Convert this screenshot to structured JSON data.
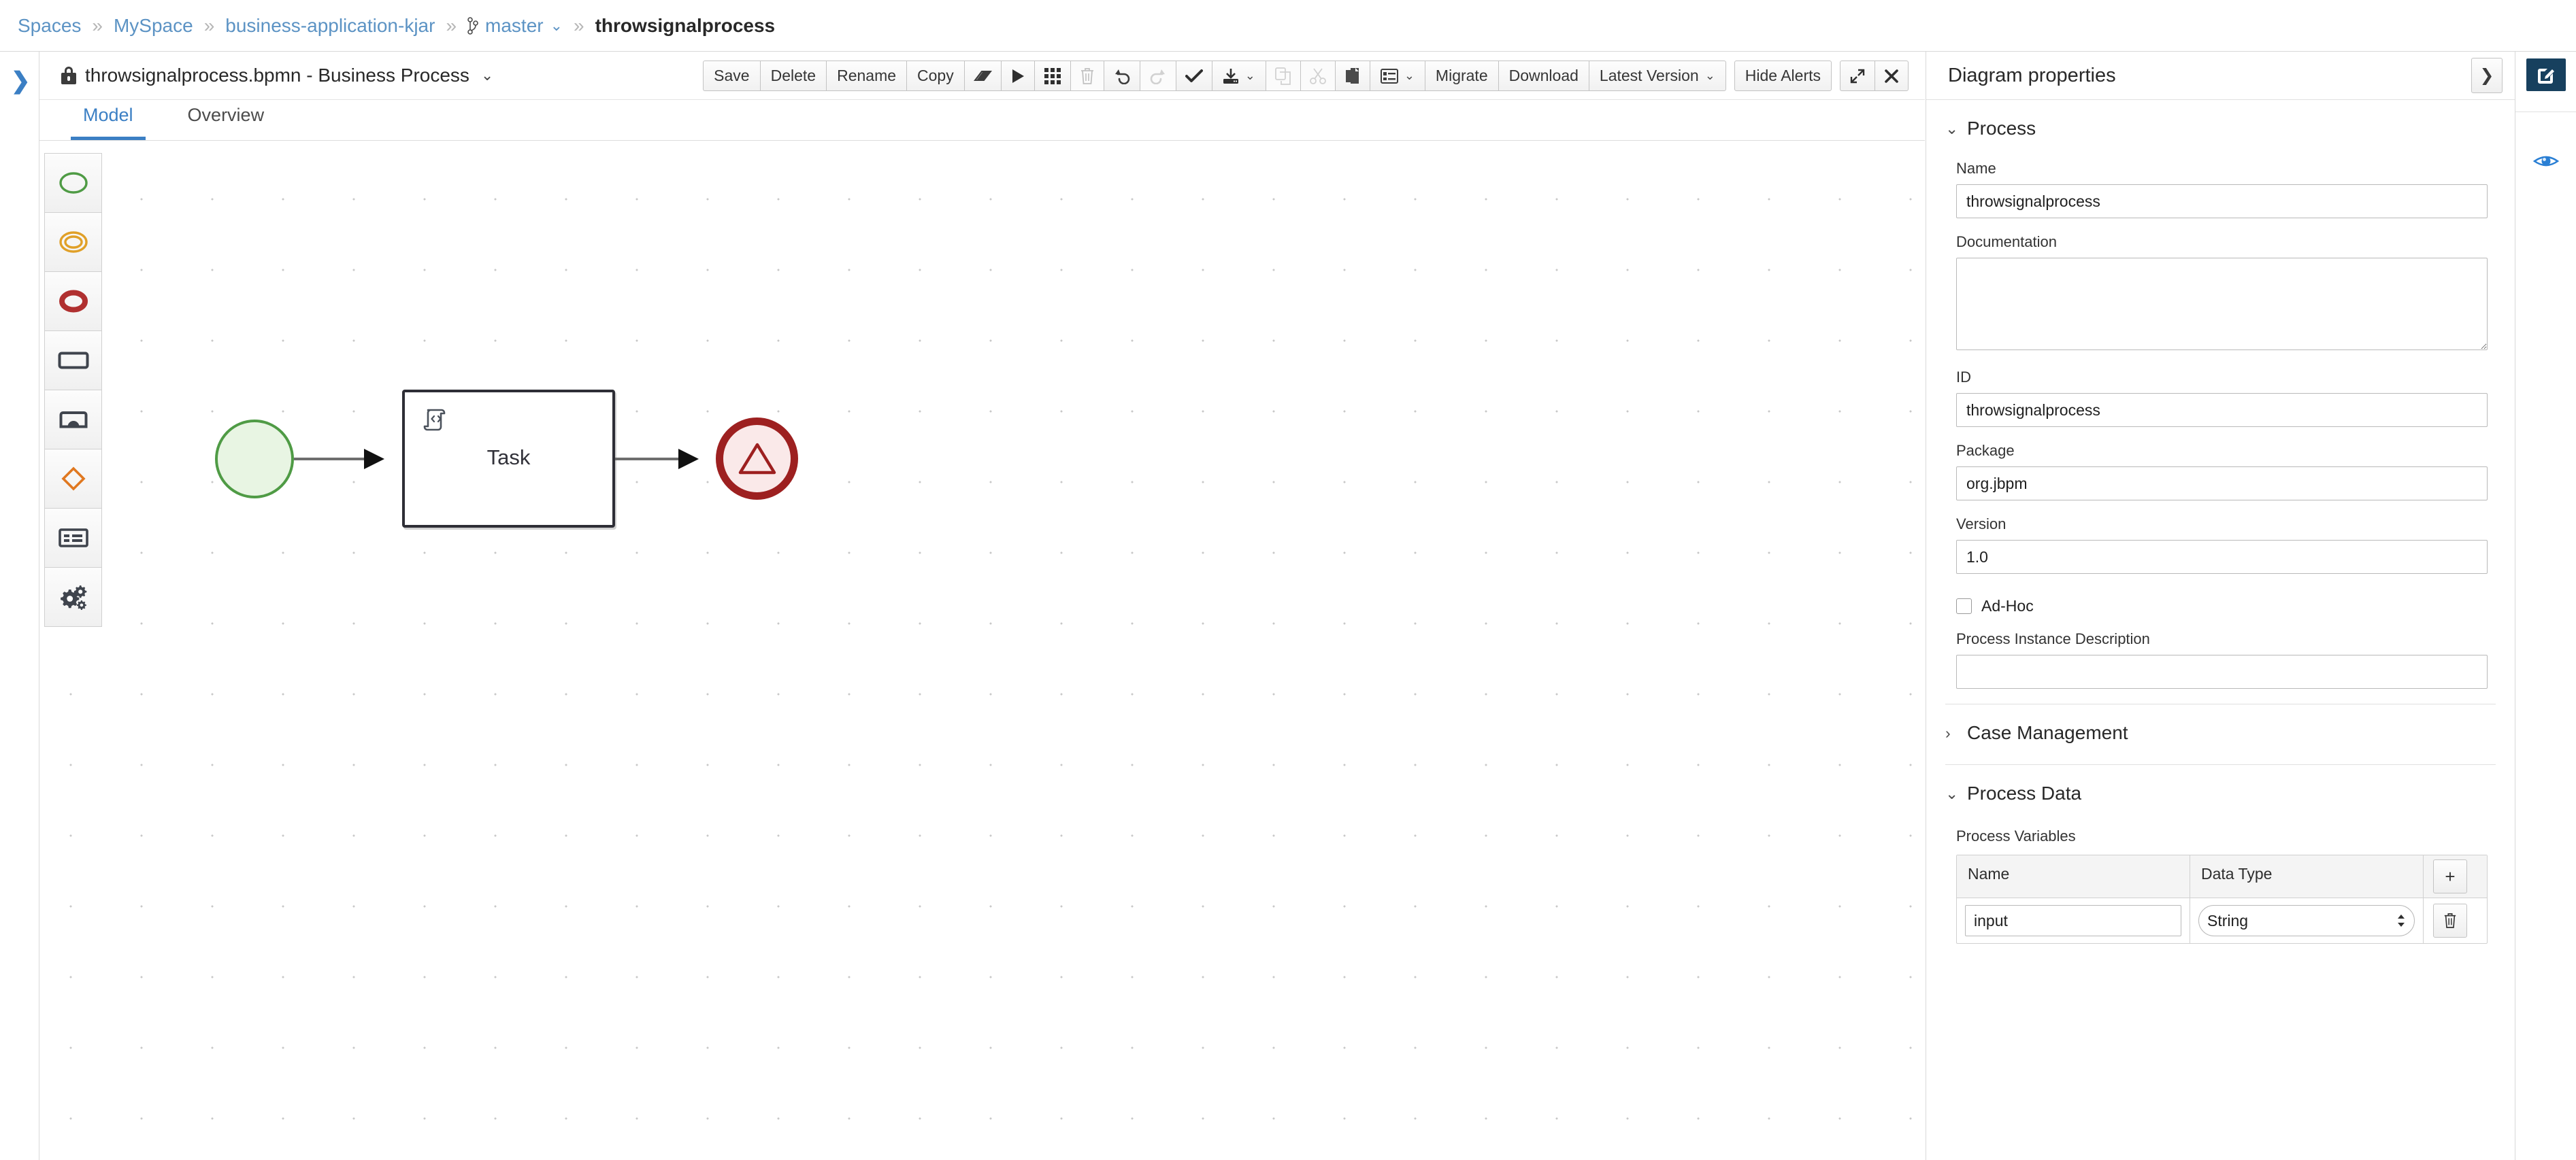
{
  "breadcrumb": {
    "items": [
      {
        "label": "Spaces",
        "type": "link"
      },
      {
        "label": "MySpace",
        "type": "link"
      },
      {
        "label": "business-application-kjar",
        "type": "link"
      },
      {
        "label": "master",
        "type": "branch"
      },
      {
        "label": "throwsignalprocess",
        "type": "current"
      }
    ],
    "separator": "»"
  },
  "editor": {
    "file_title": "throwsignalprocess.bpmn - Business Process",
    "title_caret": "⌄",
    "lock_icon": "lock-icon",
    "sidebar_expand_icon": "❯",
    "tabs": [
      {
        "label": "Model",
        "active": true
      },
      {
        "label": "Overview",
        "active": false
      }
    ]
  },
  "toolbar": {
    "groups": [
      {
        "buttons": [
          {
            "label": "Save",
            "name": "save-button",
            "kind": "text"
          },
          {
            "label": "Delete",
            "name": "delete-button",
            "kind": "text"
          },
          {
            "label": "Rename",
            "name": "rename-button",
            "kind": "text"
          },
          {
            "label": "Copy",
            "name": "copy-button",
            "kind": "text"
          },
          {
            "label": "",
            "name": "eraser-icon",
            "kind": "icon",
            "icon": "eraser"
          },
          {
            "label": "",
            "name": "run-icon",
            "kind": "icon",
            "icon": "play"
          },
          {
            "label": "",
            "name": "grid-icon",
            "kind": "icon",
            "icon": "grid"
          },
          {
            "label": "",
            "name": "delete-shape-icon",
            "kind": "icon",
            "icon": "trash",
            "disabled": true
          },
          {
            "label": "",
            "name": "undo-icon",
            "kind": "icon",
            "icon": "undo"
          },
          {
            "label": "",
            "name": "redo-icon",
            "kind": "icon",
            "icon": "redo",
            "disabled": true
          },
          {
            "label": "",
            "name": "validate-icon",
            "kind": "icon",
            "icon": "check"
          },
          {
            "label": "",
            "name": "import-icon",
            "kind": "icon",
            "icon": "import",
            "caret": "⌄"
          },
          {
            "label": "",
            "name": "copy-shape-icon",
            "kind": "icon",
            "icon": "copy",
            "disabled": true
          },
          {
            "label": "",
            "name": "cut-shape-icon",
            "kind": "icon",
            "icon": "scissors",
            "disabled": true
          },
          {
            "label": "",
            "name": "paste-shape-icon",
            "kind": "icon",
            "icon": "paste"
          },
          {
            "label": "",
            "name": "form-generation-icon",
            "kind": "icon",
            "icon": "form",
            "caret": "⌄"
          },
          {
            "label": "Migrate",
            "name": "migrate-button",
            "kind": "text"
          },
          {
            "label": "Download",
            "name": "download-button",
            "kind": "text"
          },
          {
            "label": "Latest Version",
            "name": "latest-version-button",
            "kind": "text",
            "caret": "⌄"
          }
        ]
      },
      {
        "buttons": [
          {
            "label": "Hide Alerts",
            "name": "hide-alerts-button",
            "kind": "text"
          }
        ]
      },
      {
        "buttons": [
          {
            "label": "",
            "name": "maximize-icon",
            "kind": "icon",
            "icon": "expand"
          },
          {
            "label": "",
            "name": "close-icon",
            "kind": "icon",
            "icon": "close"
          }
        ]
      }
    ]
  },
  "palette": {
    "items": [
      {
        "name": "palette-start-events",
        "icon": "start-event-circle",
        "color": "#4f9b45"
      },
      {
        "name": "palette-intermediate-events",
        "icon": "intermediate-event-double-circle",
        "color": "#e0a028"
      },
      {
        "name": "palette-end-events",
        "icon": "end-event-thick-circle",
        "color": "#b03030"
      },
      {
        "name": "palette-activities",
        "icon": "task-rectangle",
        "color": "#3f444d"
      },
      {
        "name": "palette-subprocesses",
        "icon": "subprocess-rectangle",
        "color": "#3f444d"
      },
      {
        "name": "palette-gateways",
        "icon": "gateway-diamond",
        "color": "#e07820"
      },
      {
        "name": "palette-containers",
        "icon": "lane-container",
        "color": "#3f444d"
      },
      {
        "name": "palette-service-tasks",
        "icon": "gears-icon",
        "color": "#3f444d"
      }
    ]
  },
  "diagram": {
    "nodes": [
      {
        "name": "start-event",
        "type": "start-event",
        "label": ""
      },
      {
        "name": "task-node",
        "type": "script-task",
        "label": "Task",
        "marker": "script-icon"
      },
      {
        "name": "end-event",
        "type": "signal-end-event",
        "label": ""
      }
    ],
    "task_label": "Task"
  },
  "properties": {
    "title": "Diagram properties",
    "collapse_icon": "❯",
    "sections": [
      {
        "title": "Process",
        "expanded": true,
        "caret": "⌄"
      },
      {
        "title": "Case Management",
        "expanded": false,
        "caret": "›"
      },
      {
        "title": "Process Data",
        "expanded": true,
        "caret": "⌄"
      }
    ],
    "process": {
      "name_label": "Name",
      "name_value": "throwsignalprocess",
      "documentation_label": "Documentation",
      "documentation_value": "",
      "id_label": "ID",
      "id_value": "throwsignalprocess",
      "package_label": "Package",
      "package_value": "org.jbpm",
      "version_label": "Version",
      "version_value": "1.0",
      "adhoc_label": "Ad-Hoc",
      "adhoc_checked": false,
      "instance_description_label": "Process Instance Description",
      "instance_description_value": ""
    },
    "process_data": {
      "variables_label": "Process Variables",
      "columns": [
        "Name",
        "Data Type"
      ],
      "add_button_label": "+",
      "rows": [
        {
          "name": "input",
          "data_type": "String"
        }
      ],
      "delete_button_icon": "trash-icon"
    }
  },
  "right_rail": {
    "edit_icon": "edit-pencil-icon",
    "preview_icon": "eye-icon"
  },
  "colors": {
    "link": "#5c93c4",
    "accent": "#3b7fc4",
    "start_event_stroke": "#4f9b45",
    "start_event_fill": "#e8f5e3",
    "end_event_stroke": "#9d2020",
    "end_event_fill": "#fae9e9",
    "task_stroke": "#2e2e36",
    "rail_active": "#17405e"
  }
}
